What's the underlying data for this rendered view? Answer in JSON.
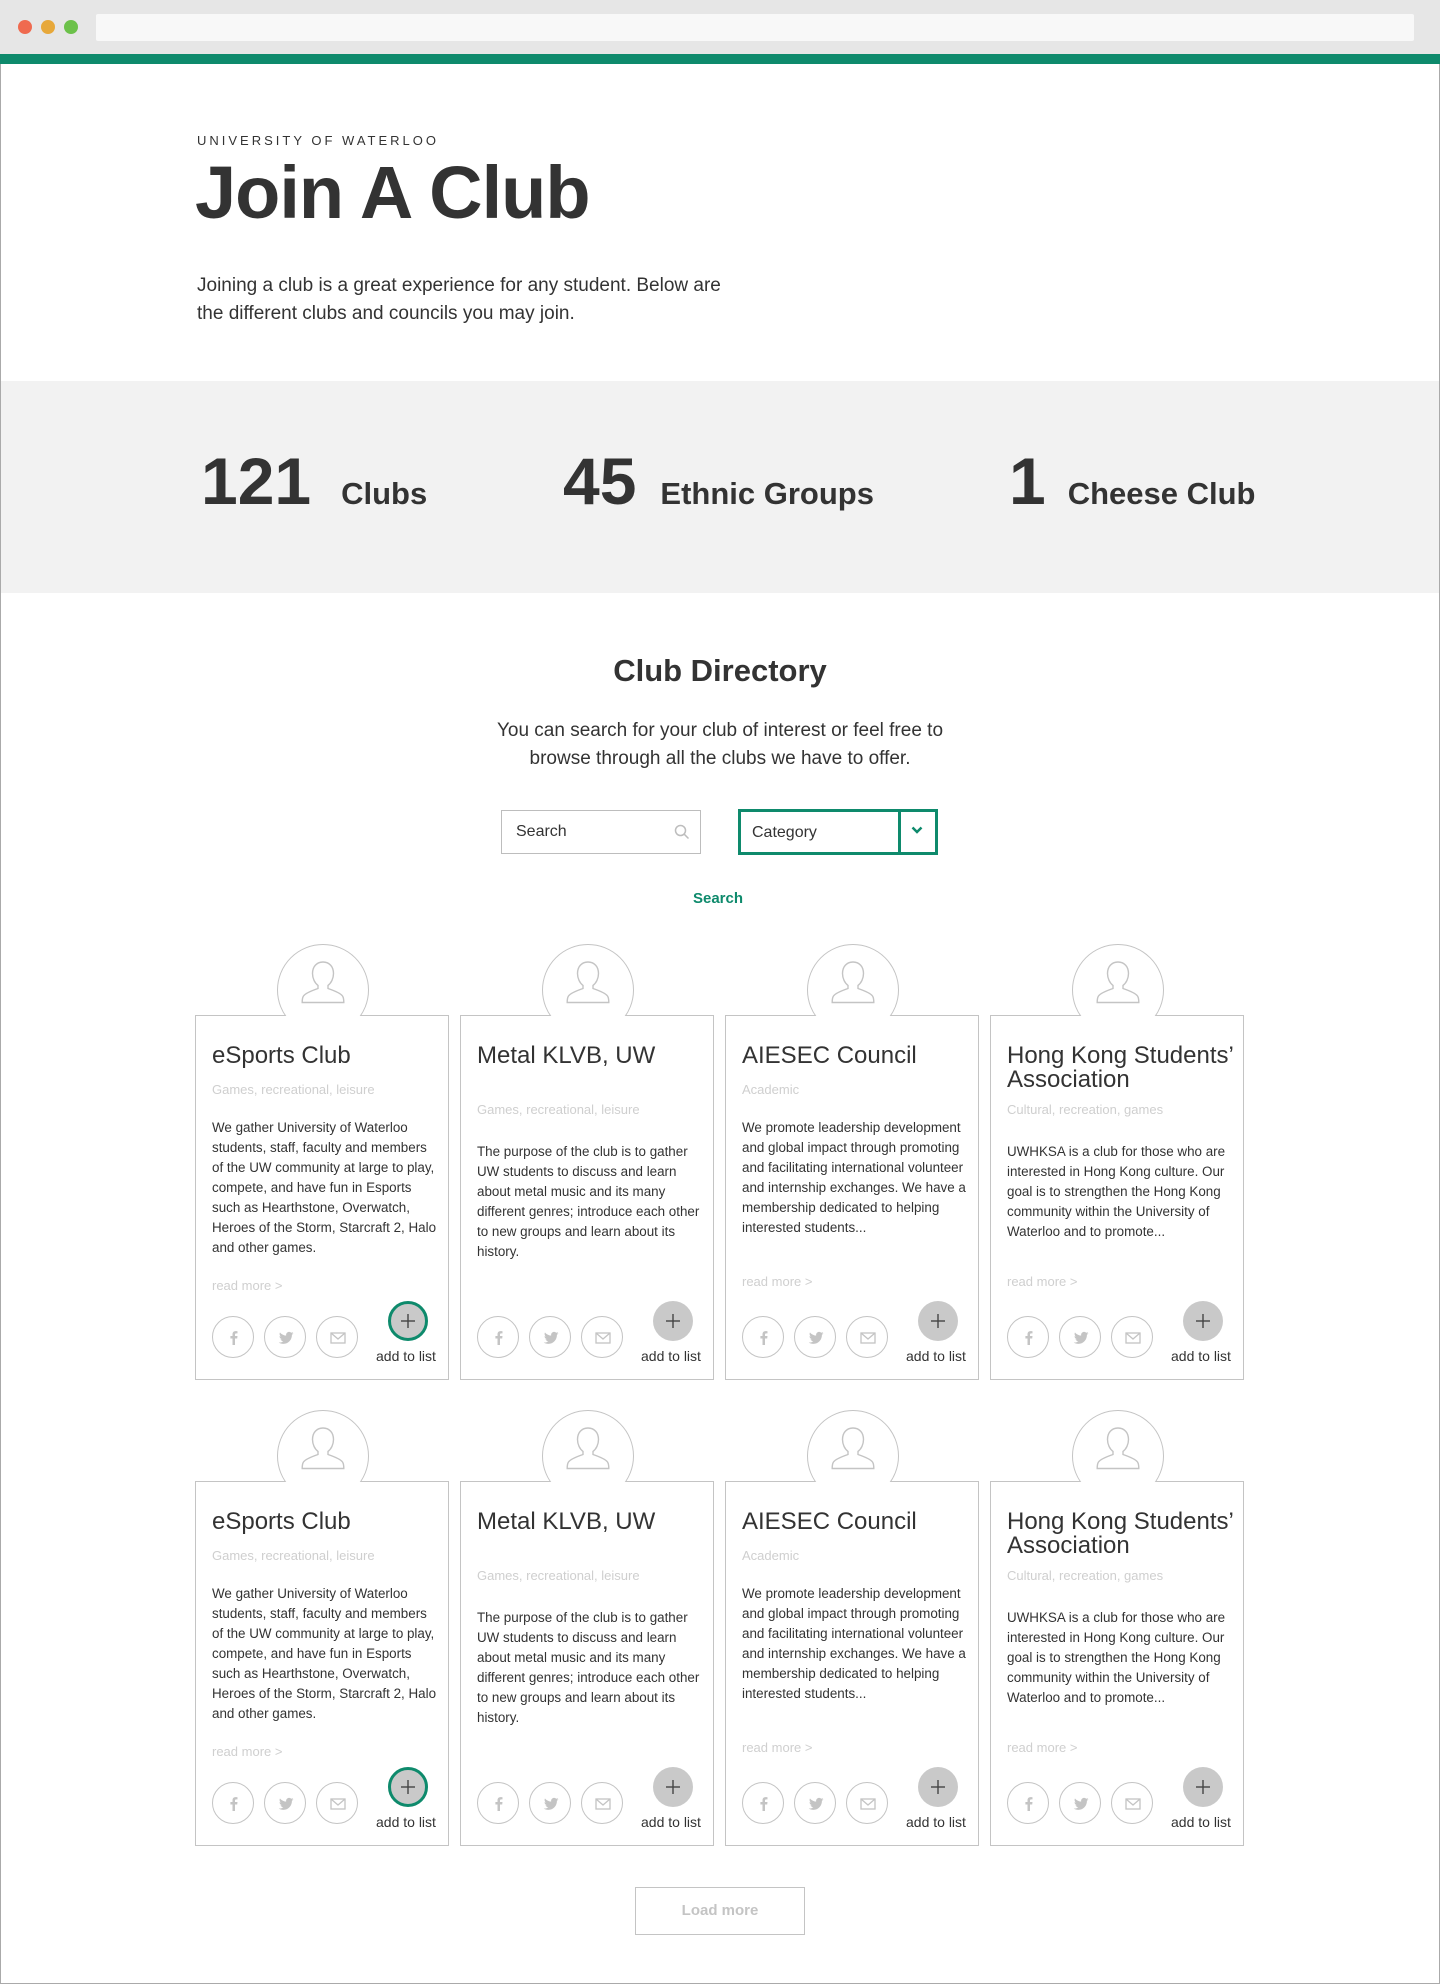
{
  "hero": {
    "eyebrow": "UNIVERSITY OF WATERLOO",
    "title": "Join A Club",
    "description": "Joining a club is a great experience for any student. Below are the different clubs and councils you may join."
  },
  "stats": [
    {
      "number": "121",
      "label": "Clubs"
    },
    {
      "number": "45",
      "label": "Ethnic Groups"
    },
    {
      "number": "1",
      "label": "Cheese Club"
    }
  ],
  "directory": {
    "title": "Club Directory",
    "description": "You can search for your club of interest or feel free to browse through all the clubs we have to offer.",
    "search_placeholder": "Search",
    "category_label": "Category",
    "search_button": "Search",
    "load_more": "Load more"
  },
  "icons": {
    "search": "search-icon",
    "dropdown": "chevron-down-icon",
    "avatar": "user-icon",
    "facebook": "facebook-icon",
    "twitter": "twitter-icon",
    "email": "email-icon",
    "add": "plus-icon"
  },
  "colors": {
    "accent": "#0e8a6c",
    "muted_text": "#cfcfcf",
    "stats_bg": "#f2f2f2",
    "add_button": "#c9c9c9"
  },
  "cards": [
    {
      "title": "eSports Club",
      "categories": "Games, recreational, leisure",
      "description": "We gather University of Waterloo students, staff, faculty and members of the UW community at large to play, compete, and have fun in Esports such as Hearthstone, Overwatch, Heroes of the Storm, Starcraft 2, Halo and other games.",
      "read_more": "read more >",
      "add_label": "add to list",
      "added": true
    },
    {
      "title": "Metal KLVB, UW",
      "categories": "Games, recreational, leisure",
      "description": "The purpose of the club is to gather UW students to discuss and learn about metal music and its many different genres; introduce each other to new groups and learn about its history.",
      "read_more": "",
      "add_label": "add to list",
      "added": false
    },
    {
      "title": "AIESEC Council",
      "categories": "Academic",
      "description": "We promote leadership development and global impact through promoting and facilitating international volunteer and internship exchanges. We have a membership dedicated to helping interested students...",
      "read_more": "read more >",
      "add_label": "add to list",
      "added": false
    },
    {
      "title": "Hong Kong Students’ Association",
      "categories": "Cultural, recreation, games",
      "description": "UWHKSA is a club for those who are interested in Hong Kong culture. Our goal is to strengthen the Hong Kong community within the University of Waterloo and to promote...",
      "read_more": "read more >",
      "add_label": "add to list",
      "added": false
    },
    {
      "title": "eSports Club",
      "categories": "Games, recreational, leisure",
      "description": "We gather University of Waterloo students, staff, faculty and members of the UW community at large to play, compete, and have fun in Esports such as Hearthstone, Overwatch, Heroes of the Storm, Starcraft 2, Halo and other games.",
      "read_more": "read more >",
      "add_label": "add to list",
      "added": true
    },
    {
      "title": "Metal KLVB, UW",
      "categories": "Games, recreational, leisure",
      "description": "The purpose of the club is to gather UW students to discuss and learn about metal music and its many different genres; introduce each other to new groups and learn about its history.",
      "read_more": "",
      "add_label": "add to list",
      "added": false
    },
    {
      "title": "AIESEC Council",
      "categories": "Academic",
      "description": "We promote leadership development and global impact through promoting and facilitating international volunteer and internship exchanges. We have a membership dedicated to helping interested students...",
      "read_more": "read more >",
      "add_label": "add to list",
      "added": false
    },
    {
      "title": "Hong Kong Students’ Association",
      "categories": "Cultural, recreation, games",
      "description": "UWHKSA is a club for those who are interested in Hong Kong culture. Our goal is to strengthen the Hong Kong community within the University of Waterloo and to promote...",
      "read_more": "read more >",
      "add_label": "add to list",
      "added": false
    }
  ]
}
